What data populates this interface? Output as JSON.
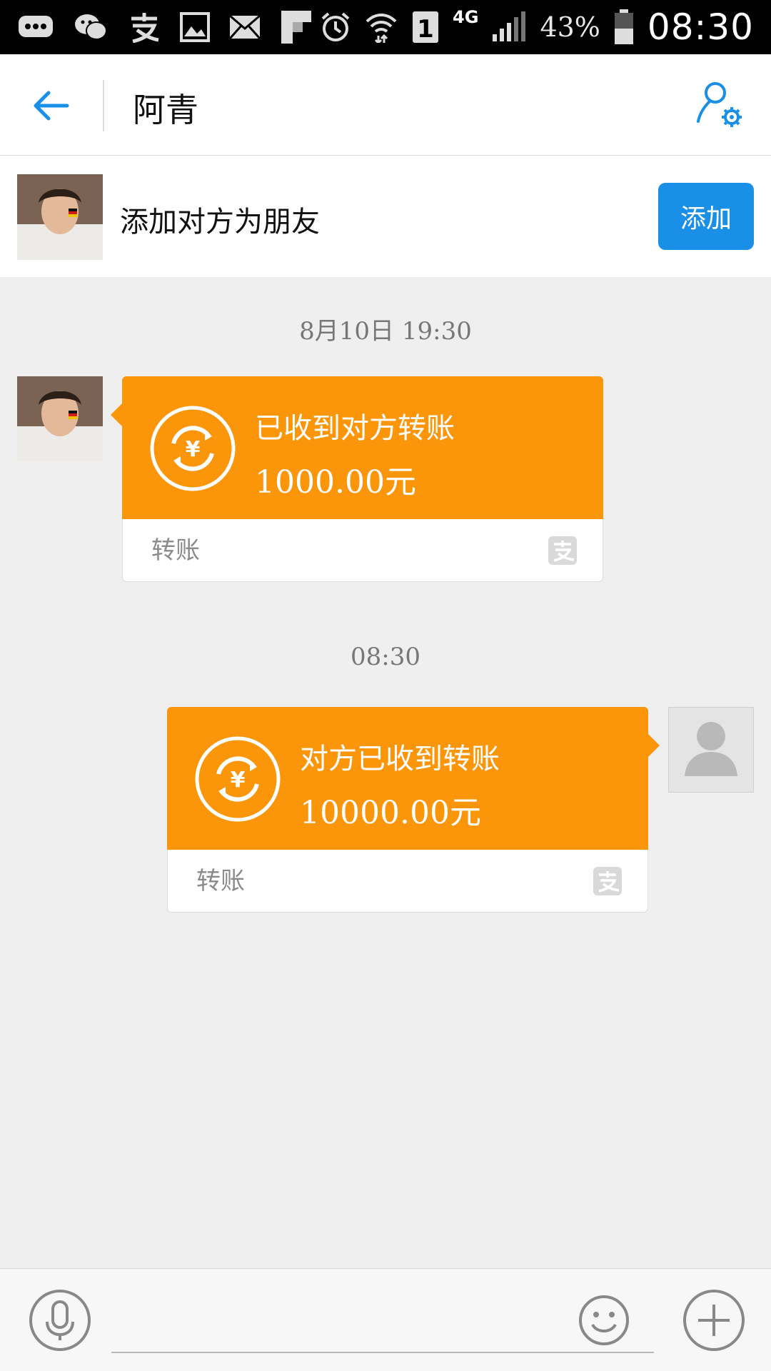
{
  "status_bar": {
    "battery_percent": "43%",
    "network": "4G",
    "sim_badge": "1",
    "time": "08:30"
  },
  "header": {
    "title": "阿青"
  },
  "add_friend": {
    "label": "添加对方为朋友",
    "button_label": "添加"
  },
  "messages": [
    {
      "timestamp": "8月10日  19:30",
      "direction": "incoming",
      "title": "已收到对方转账",
      "amount": "1000.00元",
      "type_label": "转账"
    },
    {
      "timestamp": "08:30",
      "direction": "outgoing",
      "title": "对方已收到转账",
      "amount": "10000.00元",
      "type_label": "转账"
    }
  ],
  "colors": {
    "accent_blue": "#1a8fe8",
    "transfer_orange": "#fb960b",
    "background": "#efefef"
  },
  "input_bar": {
    "placeholder": ""
  }
}
